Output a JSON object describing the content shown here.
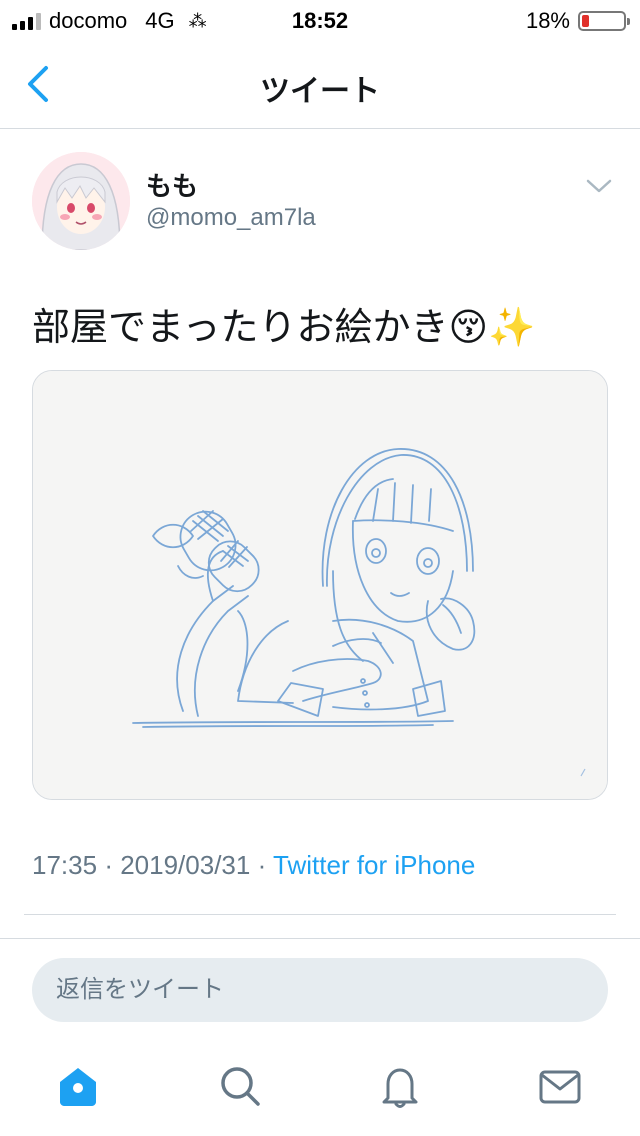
{
  "status_bar": {
    "carrier": "docomo",
    "network": "4G",
    "time": "18:52",
    "battery_percent_label": "18%",
    "battery_level": 0.18,
    "battery_color": "#e0302b"
  },
  "nav": {
    "title": "ツイート",
    "back_icon": "chevron-left-icon"
  },
  "tweet": {
    "author_name": "もも",
    "author_handle": "@momo_am7la",
    "text": "部屋でまったりお絵かき😚✨",
    "time": "17:35",
    "date": "2019/03/31",
    "separator": "·",
    "source": "Twitter for iPhone",
    "menu_icon": "chevron-down-icon",
    "media_icon": "sketch-image"
  },
  "reply": {
    "placeholder": "返信をツイート"
  },
  "tabbar": {
    "items": [
      "home-icon",
      "search-icon",
      "notifications-icon",
      "messages-icon"
    ],
    "active_color": "#1da1f2",
    "inactive_color": "#657786"
  },
  "colors": {
    "accent": "#1da1f2",
    "secondary_text": "#657786",
    "divider": "#d6dbe0"
  }
}
